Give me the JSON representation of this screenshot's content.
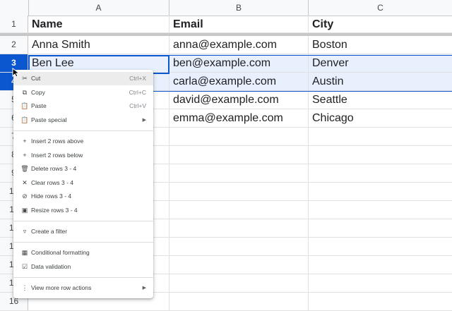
{
  "columns": [
    "A",
    "B",
    "C"
  ],
  "rows": [
    {
      "num": "1",
      "cells": [
        "Name",
        "Email",
        "City"
      ]
    },
    {
      "num": "2",
      "cells": [
        "Anna Smith",
        "anna@example.com",
        "Boston"
      ]
    },
    {
      "num": "3",
      "cells": [
        "Ben Lee",
        "ben@example.com",
        "Denver"
      ]
    },
    {
      "num": "4",
      "cells": [
        "",
        "carla@example.com",
        "Austin"
      ]
    },
    {
      "num": "5",
      "cells": [
        "",
        "david@example.com",
        "Seattle"
      ]
    },
    {
      "num": "6",
      "cells": [
        "",
        "emma@example.com",
        "Chicago"
      ]
    },
    {
      "num": "7",
      "cells": [
        "",
        "",
        ""
      ]
    },
    {
      "num": "8",
      "cells": [
        "",
        "",
        ""
      ]
    },
    {
      "num": "9",
      "cells": [
        "",
        "",
        ""
      ]
    },
    {
      "num": "10",
      "cells": [
        "",
        "",
        ""
      ]
    },
    {
      "num": "11",
      "cells": [
        "",
        "",
        ""
      ]
    },
    {
      "num": "12",
      "cells": [
        "",
        "",
        ""
      ]
    },
    {
      "num": "13",
      "cells": [
        "",
        "",
        ""
      ]
    },
    {
      "num": "14",
      "cells": [
        "",
        "",
        ""
      ]
    },
    {
      "num": "15",
      "cells": [
        "",
        "",
        ""
      ]
    },
    {
      "num": "16",
      "cells": [
        "",
        "",
        ""
      ]
    }
  ],
  "menu": {
    "cut": {
      "label": "Cut",
      "shortcut": "Ctrl+X",
      "icon": "scissors-icon"
    },
    "copy": {
      "label": "Copy",
      "shortcut": "Ctrl+C",
      "icon": "copy-icon"
    },
    "paste": {
      "label": "Paste",
      "shortcut": "Ctrl+V",
      "icon": "clipboard-icon"
    },
    "paste_special": {
      "label": "Paste special",
      "icon": "clipboard-icon"
    },
    "insert_above": {
      "label": "Insert 2 rows above",
      "icon": "plus-icon"
    },
    "insert_below": {
      "label": "Insert 2 rows below",
      "icon": "plus-icon"
    },
    "delete_rows": {
      "label": "Delete rows 3 - 4",
      "icon": "trash-icon"
    },
    "clear_rows": {
      "label": "Clear rows 3 - 4",
      "icon": "x-icon"
    },
    "hide_rows": {
      "label": "Hide rows 3 - 4",
      "icon": "eye-off-icon"
    },
    "resize_rows": {
      "label": "Resize rows 3 - 4",
      "icon": "resize-icon"
    },
    "create_filter": {
      "label": "Create a filter",
      "icon": "filter-icon"
    },
    "conditional_formatting": {
      "label": "Conditional formatting",
      "icon": "paint-roller-icon"
    },
    "data_validation": {
      "label": "Data validation",
      "icon": "validation-icon"
    },
    "more_row_actions": {
      "label": "View more row actions",
      "icon": "more-vert-icon"
    }
  },
  "colors": {
    "accent": "#0b57d0",
    "selection": "#e8f0fe",
    "header_bg": "#f8f9fa"
  }
}
